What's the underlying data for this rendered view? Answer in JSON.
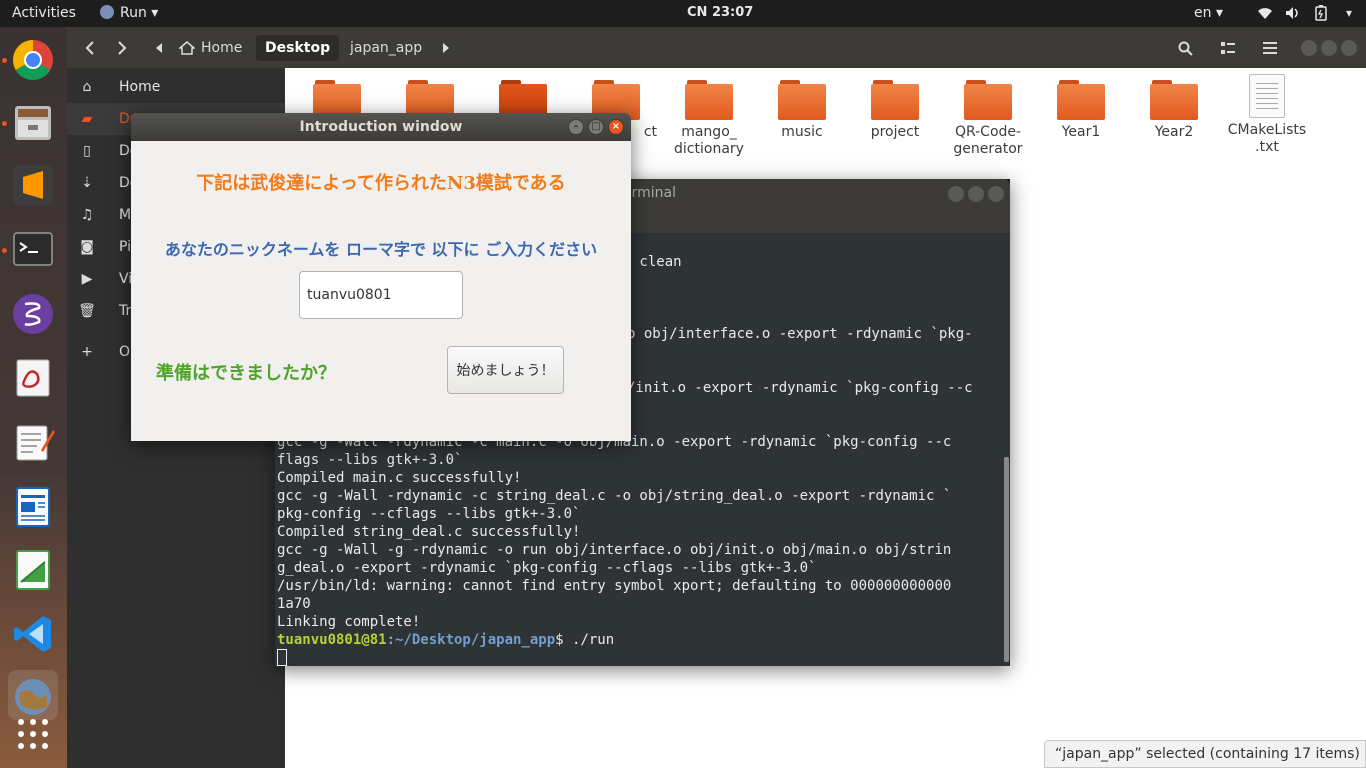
{
  "topbar": {
    "activities": "Activities",
    "app_menu": "Run",
    "clock": "CN 23:07",
    "language": "en"
  },
  "dock": {
    "items": [
      "chrome-icon",
      "files-icon",
      "sublime-text-icon",
      "terminal-icon",
      "emacs-icon",
      "document-viewer-icon",
      "text-editor-icon",
      "libreoffice-writer-icon",
      "libreoffice-calc-icon",
      "vscode-icon",
      "globe-icon",
      "show-apps-icon"
    ]
  },
  "files": {
    "breadcrumbs": [
      "Home",
      "Desktop",
      "japan_app"
    ],
    "sidebar": [
      {
        "label": "Home",
        "icon": "home-icon"
      },
      {
        "label": "De",
        "icon": "folder-icon"
      },
      {
        "label": "Do",
        "icon": "document-icon"
      },
      {
        "label": "Do",
        "icon": "download-icon"
      },
      {
        "label": "M",
        "icon": "music-icon"
      },
      {
        "label": "Pi",
        "icon": "camera-icon"
      },
      {
        "label": "Vi",
        "icon": "video-icon"
      },
      {
        "label": "Tr",
        "icon": "trash-icon"
      },
      {
        "label": "O",
        "icon": "plus-icon"
      }
    ],
    "icons": [
      {
        "label": ""
      },
      {
        "label": ""
      },
      {
        "label": ""
      },
      {
        "label": "ct"
      },
      {
        "label": "mango_\ndictionary"
      },
      {
        "label": "music"
      },
      {
        "label": "project"
      },
      {
        "label": "QR-Code-\ngenerator"
      },
      {
        "label": "Year1"
      },
      {
        "label": "Year2"
      },
      {
        "label": "CMakeLists\n.txt"
      }
    ],
    "status": "“japan_app” selected  (containing 17 items)"
  },
  "terminal": {
    "title": "erminal",
    "lines": [
      " clean",
      "o obj/interface.o -export -rdynamic `pkg-",
      "/init.o -export -rdynamic `pkg-config --c",
      "gcc -g -Wall -rdynamic -c main.c -o obj/main.o -export -rdynamic `pkg-config --c",
      "flags --libs gtk+-3.0`",
      "Compiled main.c successfully!",
      "gcc -g -Wall -rdynamic -c string_deal.c -o obj/string_deal.o -export -rdynamic `",
      "pkg-config --cflags --libs gtk+-3.0`",
      "Compiled string_deal.c successfully!",
      "gcc -g -Wall -g -rdynamic -o run obj/interface.o obj/init.o obj/main.o obj/strin",
      "g_deal.o -export -rdynamic `pkg-config --cflags --libs gtk+-3.0`",
      "/usr/bin/ld: warning: cannot find entry symbol xport; defaulting to 000000000000",
      "1a70",
      "Linking complete!"
    ],
    "prompt_user": "tuanvu0801@81",
    "prompt_path": ":~/Desktop/japan_app",
    "prompt_cmd": "$ ./run"
  },
  "dialog": {
    "title": "Introduction window",
    "heading": "下記は武俊達によって作られたN3模試である",
    "prompt": "あなたのニックネームを ローマ字で 以下に ご入力ください",
    "nickname_value": "tuanvu0801",
    "ready_text": "準備はできましたか？",
    "start_button": "始めましょう！"
  }
}
